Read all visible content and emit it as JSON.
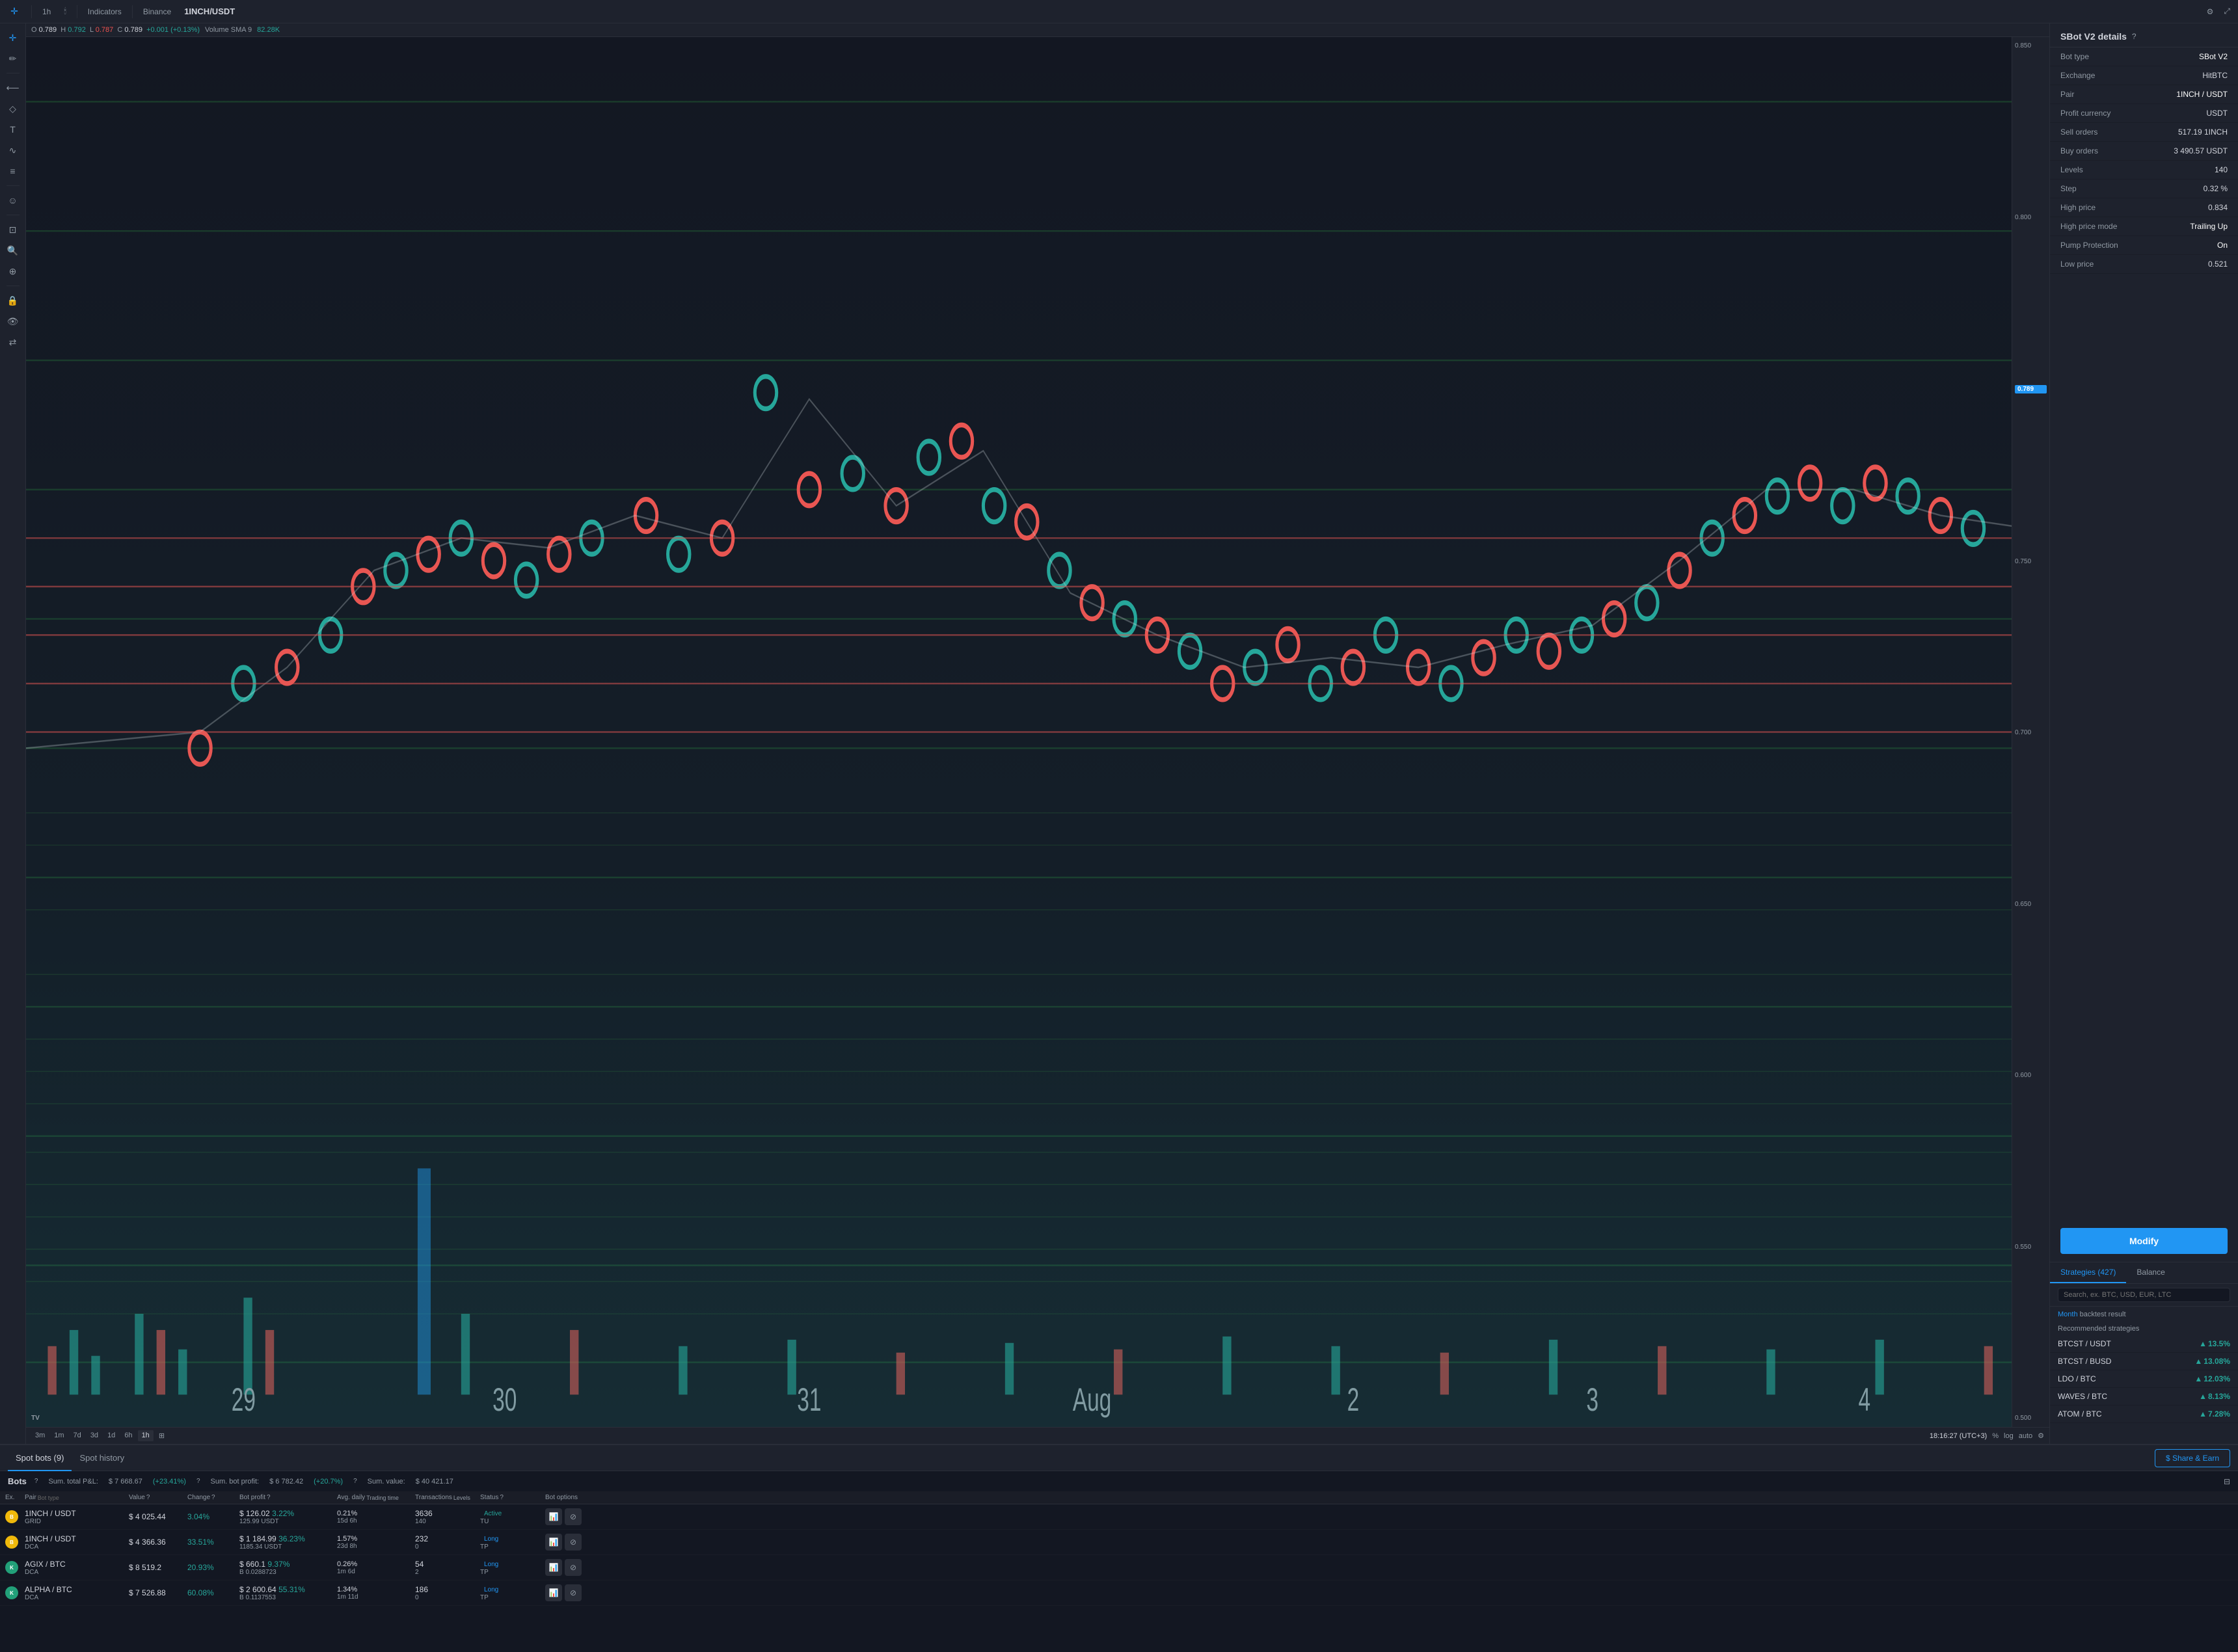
{
  "toolbar": {
    "timeframe": "1h",
    "indicators_label": "Indicators",
    "exchange": "Binance",
    "pair": "1INCH/USDT",
    "settings_icon": "⚙",
    "fullscreen_icon": "⤢"
  },
  "chart": {
    "ohlc": {
      "open_label": "O",
      "open_value": "0.789",
      "high_label": "H",
      "high_value": "0.792",
      "low_label": "L",
      "low_value": "0.787",
      "close_label": "C",
      "close_value": "0.789",
      "change": "+0.001 (+0.13%)"
    },
    "volume_label": "Volume SMA 9",
    "volume_value": "82.28K",
    "current_price": "0.789",
    "price_levels": [
      "0.850",
      "0.800",
      "0.750",
      "0.700",
      "0.650",
      "0.600",
      "0.550",
      "0.500"
    ],
    "date_labels": [
      "29",
      "30",
      "31",
      "Aug",
      "2",
      "3",
      "4"
    ],
    "time_display": "18:16:27 (UTC+3)",
    "timeframes": [
      "3m",
      "1m",
      "7d",
      "3d",
      "1d",
      "6h",
      "1h"
    ],
    "active_timeframe": "1h",
    "chart_options": [
      "%",
      "log",
      "auto"
    ]
  },
  "right_panel": {
    "title": "SBot V2 details",
    "help_icon": "?",
    "details": [
      {
        "label": "Bot type",
        "value": "SBot V2"
      },
      {
        "label": "Exchange",
        "value": "HitBTC"
      },
      {
        "label": "Pair",
        "value": "1INCH / USDT"
      },
      {
        "label": "Profit currency",
        "value": "USDT"
      },
      {
        "label": "Sell orders",
        "value": "517.19 1INCH"
      },
      {
        "label": "Buy orders",
        "value": "3 490.57 USDT"
      },
      {
        "label": "Levels",
        "value": "140"
      },
      {
        "label": "Step",
        "value": "0.32 %"
      },
      {
        "label": "High price",
        "value": "0.834"
      },
      {
        "label": "High price mode",
        "value": "Trailing Up"
      },
      {
        "label": "Pump Protection",
        "value": "On"
      },
      {
        "label": "Low price",
        "value": "0.521"
      }
    ],
    "modify_btn": "Modify"
  },
  "strategies": {
    "tab_strategies": "Strategies (427)",
    "tab_balance": "Balance",
    "search_placeholder": "Search, ex. BTC, USD, EUR, LTC",
    "backtest_month": "Month",
    "backtest_label": "backtest result",
    "recommended_label": "Recommended strategies",
    "items": [
      {
        "name": "BTCST / USDT",
        "pct": "13.5%"
      },
      {
        "name": "BTCST / BUSD",
        "pct": "13.08%"
      },
      {
        "name": "LDO / BTC",
        "pct": "12.03%"
      },
      {
        "name": "WAVES / BTC",
        "pct": "8.13%"
      },
      {
        "name": "ATOM / BTC",
        "pct": "7.28%"
      }
    ]
  },
  "bottom": {
    "tab_spot_bots": "Spot bots (9)",
    "tab_spot_history": "Spot history",
    "share_earn_btn": "$ Share & Earn",
    "bots_title": "Bots",
    "stats": {
      "pnl_label": "Sum. total P&L:",
      "pnl_value": "$ 7 668.67",
      "pnl_pct": "(+23.41%)",
      "profit_label": "Sum. bot profit:",
      "profit_value": "$ 6 782.42",
      "profit_pct": "(+20.7%)",
      "value_label": "Sum. value:",
      "value_value": "$ 40 421.17"
    },
    "table_headers": [
      "Ex.",
      "Pair\nBot type",
      "Value ?",
      "Change ?",
      "Bot profit ?",
      "Avg. daily\nTrading time",
      "Transactions\nLevels",
      "Status ?",
      "Bot options"
    ],
    "rows": [
      {
        "exchange_icon": "B",
        "exchange_color": "#f0b90b",
        "pair": "1INCH / USDT",
        "bot_type": "GRID",
        "value": "$ 4 025.44",
        "change": "3.04%",
        "profit_main": "$ 126.02",
        "profit_pct": "3.22%",
        "profit_sub": "125.99 USDT",
        "avg_daily": "0.21%",
        "trading_time": "15d 6h",
        "tx_main": "3636",
        "tx_sub": "140",
        "status": "Active",
        "status_type": "active",
        "status_sub": "TU"
      },
      {
        "exchange_icon": "B",
        "exchange_color": "#f0b90b",
        "pair": "1INCH / USDT",
        "bot_type": "DCA",
        "value": "$ 4 366.36",
        "change": "33.51%",
        "profit_main": "$ 1 184.99",
        "profit_pct": "36.23%",
        "profit_sub": "1185.34 USDT",
        "avg_daily": "1.57%",
        "trading_time": "23d 8h",
        "tx_main": "232",
        "tx_sub": "0",
        "status": "Long",
        "status_type": "long",
        "status_sub": "TP"
      },
      {
        "exchange_icon": "K",
        "exchange_color": "#22a079",
        "pair": "AGIX / BTC",
        "bot_type": "DCA",
        "value": "$ 8 519.2",
        "change": "20.93%",
        "profit_main": "$ 660.1",
        "profit_pct": "9.37%",
        "profit_sub": "B 0.0288723",
        "avg_daily": "0.26%",
        "trading_time": "1m 6d",
        "tx_main": "54",
        "tx_sub": "2",
        "status": "Long",
        "status_type": "long",
        "status_sub": "TP"
      },
      {
        "exchange_icon": "K",
        "exchange_color": "#22a079",
        "pair": "ALPHA / BTC",
        "bot_type": "DCA",
        "value": "$ 7 526.88",
        "change": "60.08%",
        "profit_main": "$ 2 600.64",
        "profit_pct": "55.31%",
        "profit_sub": "B 0.1137553",
        "avg_daily": "1.34%",
        "trading_time": "1m 11d",
        "tx_main": "186",
        "tx_sub": "0",
        "status": "Long",
        "status_type": "long",
        "status_sub": "TP"
      }
    ]
  },
  "tools": {
    "icons": [
      "+",
      "✏",
      "≡",
      "✦",
      "⟨",
      "T",
      "∿",
      "≋",
      "☺",
      "⊡",
      "🔍",
      "⊕",
      "🔔",
      "✒",
      "🔒",
      "👁",
      "⇄"
    ]
  }
}
